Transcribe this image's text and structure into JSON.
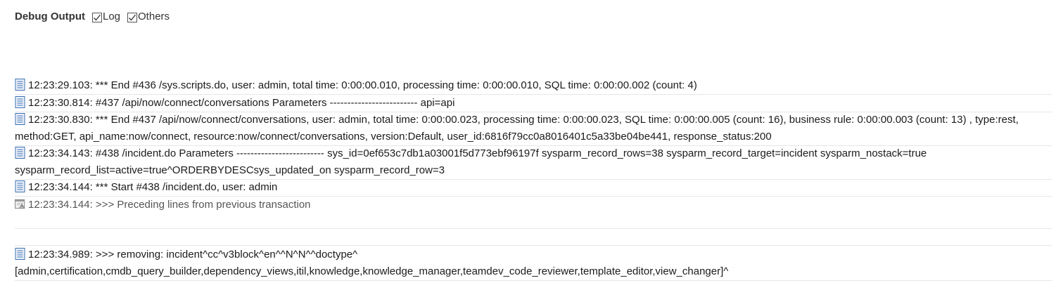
{
  "header": {
    "title": "Debug Output",
    "checkboxes": [
      {
        "label": "Log",
        "checked": true
      },
      {
        "label": "Others",
        "checked": true
      }
    ]
  },
  "icons": {
    "log_entry": "document-icon",
    "previous_transaction": "calendar-warning-icon"
  },
  "entries": [
    {
      "text": "12:23:29.103: *** End #436 /sys.scripts.do, user: admin, total time: 0:00:00.010, processing time: 0:00:00.010, SQL time: 0:00:00.002 (count: 4)"
    },
    {
      "text": "12:23:30.814: #437 /api/now/connect/conversations Parameters ------------------------- api=api"
    },
    {
      "text": "12:23:30.830: *** End #437 /api/now/connect/conversations, user: admin, total time: 0:00:00.023, processing time: 0:00:00.023, SQL time: 0:00:00.005 (count: 16), business rule: 0:00:00.003 (count: 13) , type:rest, method:GET, api_name:now/connect, resource:now/connect/conversations, version:Default, user_id:6816f79cc0a8016401c5a33be04be441, response_status:200"
    },
    {
      "text": "12:23:34.143: #438 /incident.do Parameters ------------------------- sys_id=0ef653c7db1a03001f5d773ebf96197f sysparm_record_rows=38 sysparm_record_target=incident sysparm_nostack=true sysparm_record_list=active=true^ORDERBYDESCsys_updated_on sysparm_record_row=3"
    },
    {
      "text": "12:23:34.144: *** Start #438 /incident.do, user: admin"
    },
    {
      "text": "12:23:34.144: >>> Preceding lines from previous transaction"
    },
    {
      "text": "12:23:34.989: >>> removing: incident^cc^v3block^en^^N^N^^doctype^ [admin,certification,cmdb_query_builder,dependency_views,itil,knowledge,knowledge_manager,teamdev_code_reviewer,template_editor,view_changer]^"
    }
  ],
  "colors": {
    "text": "#1b1b1b",
    "muted_text": "#555555",
    "divider": "#e4e6e8",
    "icon_blue": "#3a6fb0"
  }
}
